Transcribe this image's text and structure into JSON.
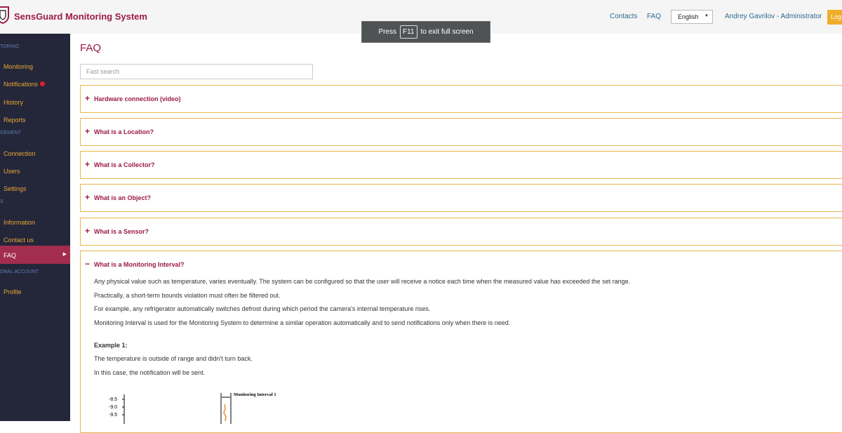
{
  "header": {
    "app_title": "SensGuard Monitoring System",
    "links": {
      "contacts": "Contacts",
      "faq": "FAQ"
    },
    "language": "English",
    "user": "Andrey Gavrilov - Administrator",
    "logout_label": "Log",
    "brand_color": "#9b1b45",
    "accent_color": "#f0ad2b"
  },
  "fullscreen_notice": {
    "prefix": "Press",
    "key": "F11",
    "suffix": "to exit full screen"
  },
  "sidebar": {
    "sections": [
      "TORING",
      "GEMENT",
      "S",
      "ONAL ACCOUNT"
    ],
    "items": [
      {
        "label": "Monitoring"
      },
      {
        "label": "Notifications",
        "badge": "red-dot"
      },
      {
        "label": "History"
      },
      {
        "label": "Reports"
      },
      {
        "label": "Connection"
      },
      {
        "label": "Users"
      },
      {
        "label": "Settings"
      },
      {
        "label": "Information"
      },
      {
        "label": "Contact us"
      },
      {
        "label": "FAQ",
        "active": true
      },
      {
        "label": "Profile"
      }
    ]
  },
  "main": {
    "title": "FAQ",
    "search_placeholder": "Fast search",
    "faq_items": [
      {
        "sign": "+",
        "question": "Hardware connection (video)"
      },
      {
        "sign": "+",
        "question": "What is a Location?"
      },
      {
        "sign": "+",
        "question": "What is a Collector?"
      },
      {
        "sign": "+",
        "question": "What is an Object?"
      },
      {
        "sign": "+",
        "question": "What is a Sensor?"
      },
      {
        "sign": "−",
        "question": "What is a Monitoring Interval?",
        "expanded": true
      }
    ],
    "answer": {
      "paragraphs": [
        "Any physical value such as temperature, varies eventually. The system can be configured so that the user will receive a notice each time when the measured value has exceeded the set range.",
        "Practically, a short-term bounds violation must often be filtered out.",
        "For example, any refrigerator automatically switches defrost during which period the camera's internal temperature rises.",
        "Monitoring Interval is used for the Monitoring System to determine a similar operation automatically and to send notifications only when there is need."
      ],
      "example_title": "Example 1:",
      "example_lines": [
        "The temperature is outside of range and didn't turn back.",
        "In this case, the notification will be sent."
      ],
      "figure": {
        "y_ticks": [
          "-8.5",
          "-9.0",
          "-9.5"
        ],
        "interval_label": "Monitoring Interval 1"
      }
    }
  }
}
